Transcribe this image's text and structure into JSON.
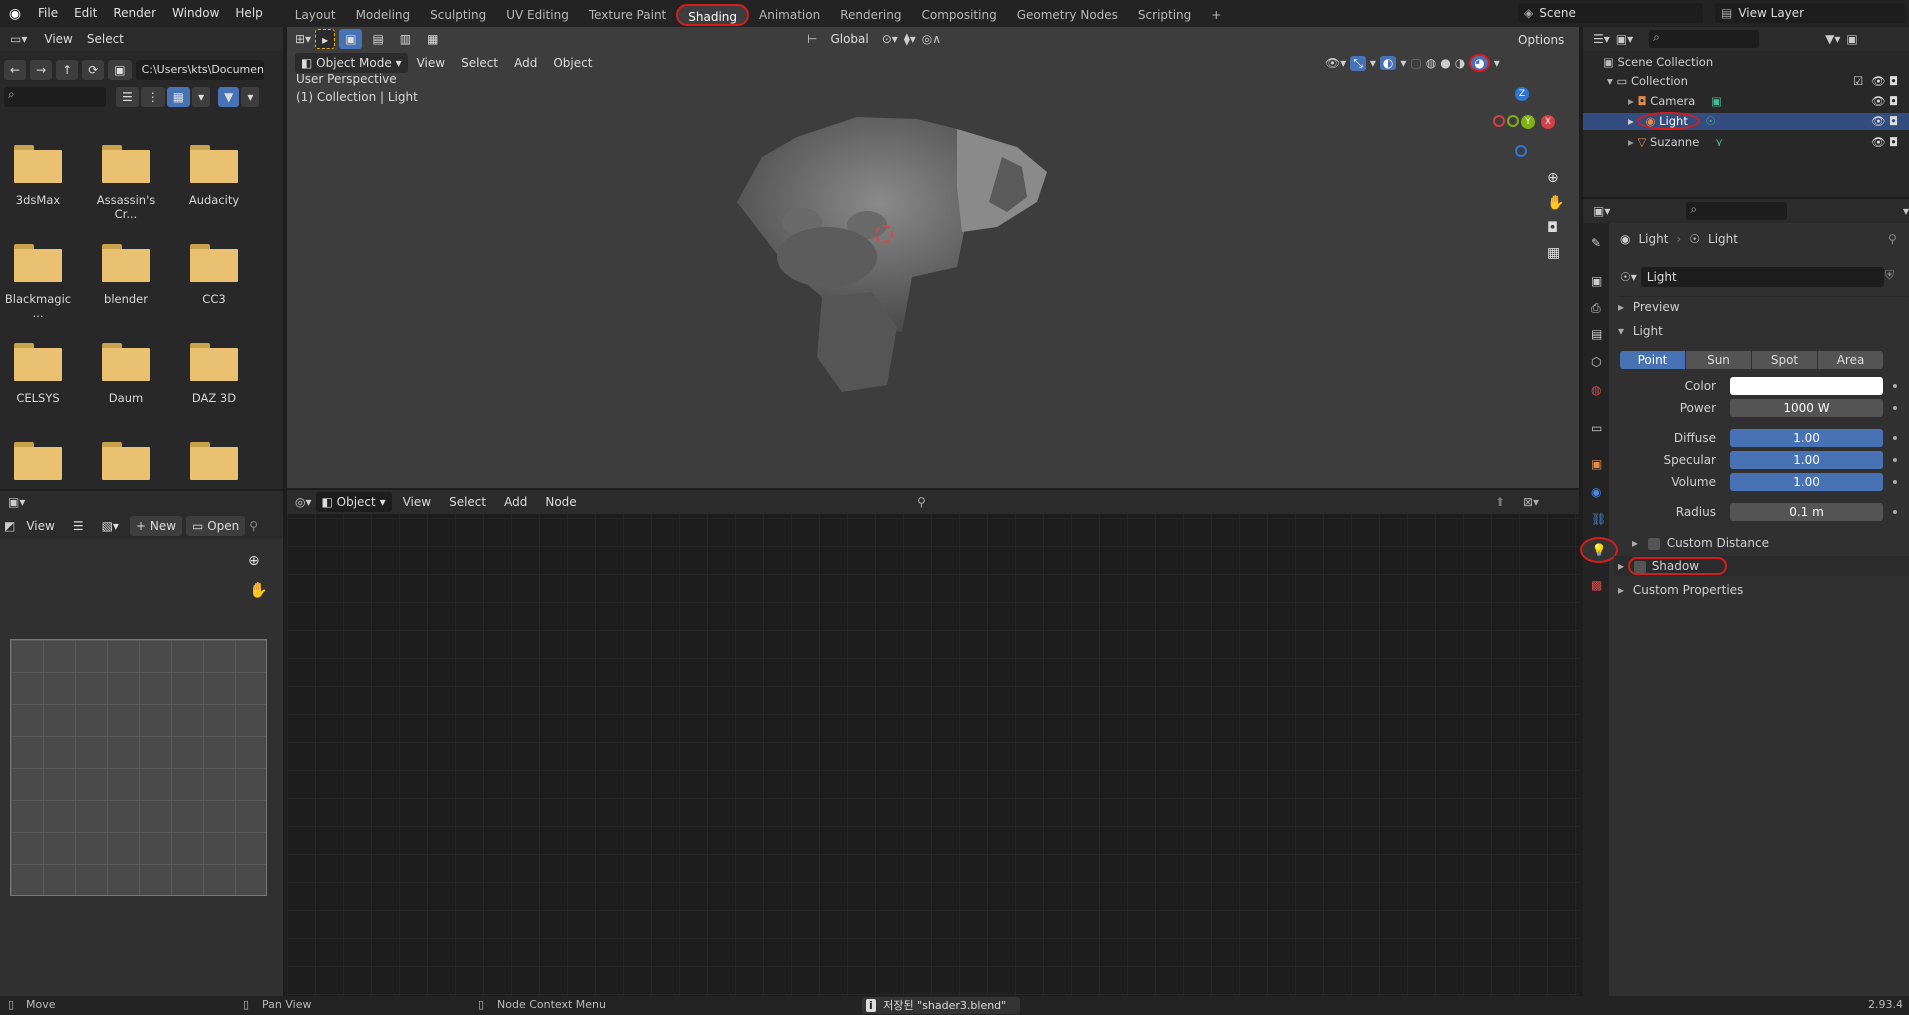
{
  "menu": [
    "File",
    "Edit",
    "Render",
    "Window",
    "Help"
  ],
  "workspaces": [
    "Layout",
    "Modeling",
    "Sculpting",
    "UV Editing",
    "Texture Paint",
    "Shading",
    "Animation",
    "Rendering",
    "Compositing",
    "Geometry Nodes",
    "Scripting"
  ],
  "active_workspace": "Shading",
  "scene": "Scene",
  "view_layer": "View Layer",
  "file_browser": {
    "menu": [
      "View",
      "Select"
    ],
    "path": "C:\\Users\\kts\\Documen...",
    "folders": [
      "3dsMax",
      "Assassin's Cr...",
      "Audacity",
      "Blackmagic ...",
      "blender",
      "CC3",
      "CELSYS",
      "Daum",
      "DAZ 3D",
      "",
      "",
      ""
    ]
  },
  "viewport": {
    "mode": "Object Mode",
    "menu": [
      "View",
      "Select",
      "Add",
      "Object"
    ],
    "orientation": "Global",
    "options": "Options",
    "info_line1": "User Perspective",
    "info_line2": "(1) Collection | Light",
    "gizmo": {
      "z": "Z",
      "y": "Y",
      "x": "X"
    }
  },
  "image_editor": {
    "view": "View",
    "new": "New",
    "open": "Open"
  },
  "node_editor": {
    "type": "Object",
    "menu": [
      "View",
      "Select",
      "Add",
      "Node"
    ]
  },
  "outliner": {
    "scene_collection": "Scene Collection",
    "collection": "Collection",
    "items": [
      "Camera",
      "Light",
      "Suzanne"
    ]
  },
  "properties": {
    "breadcrumb_object": "Light",
    "breadcrumb_data": "Light",
    "datablock": "Light",
    "preview": "Preview",
    "light_section": "Light",
    "types": [
      "Point",
      "Sun",
      "Spot",
      "Area"
    ],
    "active_type": "Point",
    "color_label": "Color",
    "power_label": "Power",
    "power": "1000 W",
    "diffuse_label": "Diffuse",
    "diffuse": "1.00",
    "specular_label": "Specular",
    "specular": "1.00",
    "volume_label": "Volume",
    "volume": "1.00",
    "radius_label": "Radius",
    "radius": "0.1 m",
    "custom_distance": "Custom Distance",
    "shadow": "Shadow",
    "custom_properties": "Custom Properties"
  },
  "status": {
    "move": "Move",
    "pan": "Pan View",
    "context": "Node Context Menu",
    "saved": "저장된 \"shader3.blend\"",
    "version": "2.93.4"
  },
  "colors": {
    "accent": "#4772b3",
    "annotation": "#d41e1e",
    "folder": "#e9c170"
  }
}
